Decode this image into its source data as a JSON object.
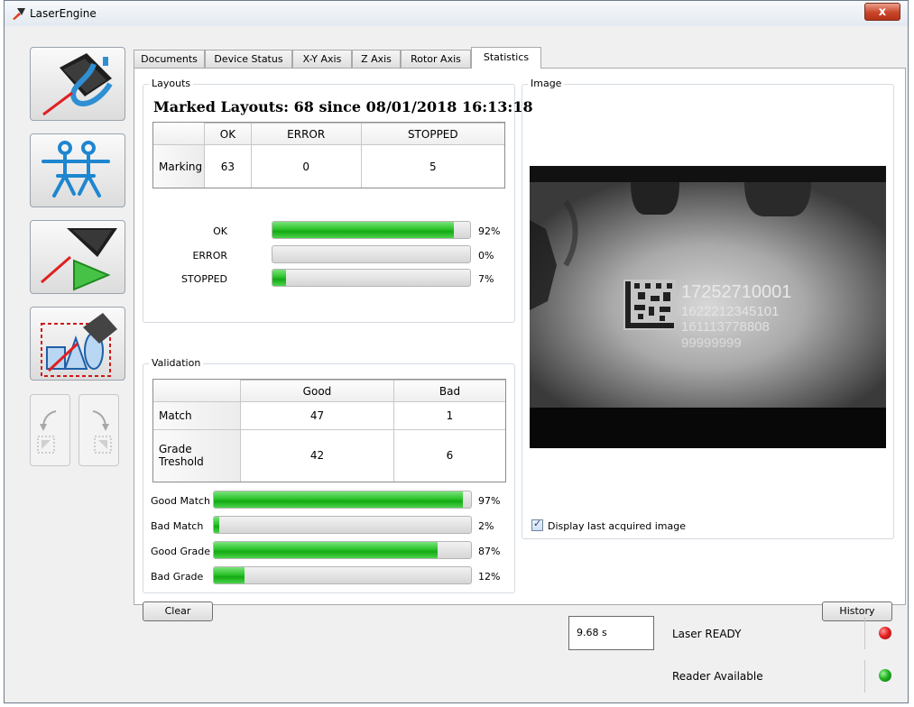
{
  "window": {
    "title": "LaserEngine",
    "close_glyph": "x"
  },
  "toolbar": {
    "buttons": [
      {
        "icon": "laser-head-icon",
        "label": ""
      },
      {
        "icon": "users-icon",
        "label": ""
      },
      {
        "icon": "start-marking-icon",
        "label": ""
      },
      {
        "icon": "layout-shapes-icon",
        "label": ""
      }
    ],
    "nav": [
      {
        "icon": "undo-icon"
      },
      {
        "icon": "redo-icon"
      }
    ]
  },
  "tabs": [
    "Documents",
    "Device Status",
    "X-Y Axis",
    "Z Axis",
    "Rotor Axis",
    "Statistics"
  ],
  "active_tab": "Statistics",
  "layouts": {
    "group_label": "Layouts",
    "marked_title": "Marked Layouts: 68 since 08/01/2018 16:13:18",
    "table": {
      "columns": [
        "OK",
        "ERROR",
        "STOPPED"
      ],
      "rows": [
        {
          "label": "Marking",
          "values": [
            "63",
            "0",
            "5"
          ]
        }
      ]
    },
    "bars": [
      {
        "label": "OK",
        "value": 92,
        "pct": "92%"
      },
      {
        "label": "ERROR",
        "value": 0,
        "pct": "0%"
      },
      {
        "label": "STOPPED",
        "value": 7,
        "pct": "7%"
      }
    ]
  },
  "validation": {
    "group_label": "Validation",
    "table": {
      "columns": [
        "Good",
        "Bad"
      ],
      "rows": [
        {
          "label": "Match",
          "values": [
            "47",
            "1"
          ]
        },
        {
          "label": "Grade Treshold",
          "values": [
            "42",
            "6"
          ]
        }
      ]
    },
    "bars": [
      {
        "label": "Good Match",
        "value": 97,
        "pct": "97%"
      },
      {
        "label": "Bad Match",
        "value": 2,
        "pct": "2%"
      },
      {
        "label": "Good Grade",
        "value": 87,
        "pct": "87%"
      },
      {
        "label": "Bad Grade",
        "value": 12,
        "pct": "12%"
      }
    ]
  },
  "image": {
    "group_label": "Image",
    "marking_lines": [
      "17252710001",
      "1622212345101",
      "161113778808",
      "99999999"
    ],
    "checkbox_label": "Display last acquired image",
    "checkbox_checked": true
  },
  "actions": {
    "clear": "Clear",
    "history": "History"
  },
  "status": {
    "time": "9.68 s",
    "laser": "Laser READY",
    "laser_led": "#e52222",
    "reader": "Reader Available",
    "reader_led": "#22b322"
  }
}
